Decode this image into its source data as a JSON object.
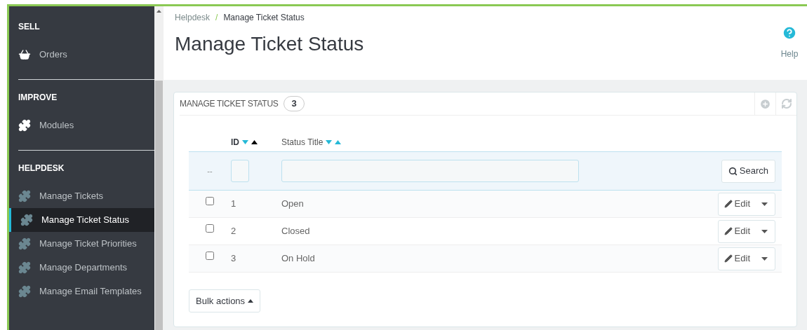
{
  "sidebar": {
    "sections": [
      {
        "title": "SELL",
        "items": [
          {
            "label": "Orders",
            "kind": "basket",
            "selected": false
          }
        ]
      },
      {
        "title": "IMPROVE",
        "items": [
          {
            "label": "Modules",
            "kind": "puzzle",
            "selected": false
          }
        ]
      },
      {
        "title": "HELPDESK",
        "items": [
          {
            "label": "Manage Tickets",
            "kind": "submodule",
            "selected": false
          },
          {
            "label": "Manage Ticket Status",
            "kind": "submodule",
            "selected": true
          },
          {
            "label": "Manage Ticket Priorities",
            "kind": "submodule",
            "selected": false
          },
          {
            "label": "Manage Departments",
            "kind": "submodule",
            "selected": false
          },
          {
            "label": "Manage Email Templates",
            "kind": "submodule",
            "selected": false
          }
        ]
      }
    ]
  },
  "breadcrumb": [
    "Helpdesk",
    "/",
    "Manage Ticket Status"
  ],
  "page_title": "Manage Ticket Status",
  "help": "Help",
  "panel": {
    "title": "MANAGE TICKET STATUS",
    "count": "3",
    "columns": [
      {
        "label": "ID",
        "sorted": true
      },
      {
        "label": "Status Title",
        "sorted": false
      }
    ],
    "filter": {
      "placeholder_mark": "--",
      "search": "Search"
    },
    "rows": [
      {
        "checked": false,
        "id": "1",
        "title": "Open",
        "action": "Edit"
      },
      {
        "checked": false,
        "id": "2",
        "title": "Closed",
        "action": "Edit"
      },
      {
        "checked": false,
        "id": "3",
        "title": "On Hold",
        "action": "Edit"
      }
    ],
    "bulk": "Bulk actions"
  }
}
